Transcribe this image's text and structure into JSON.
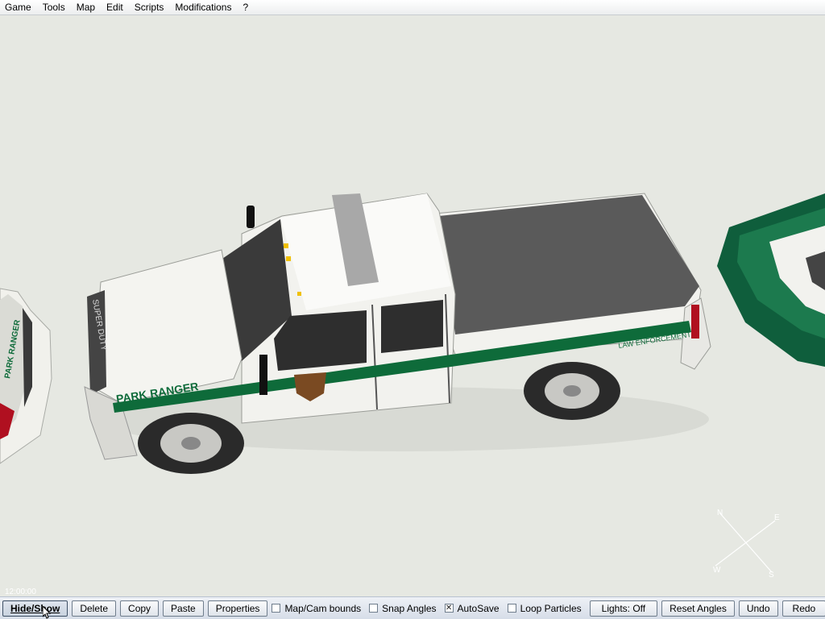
{
  "menu": {
    "items": [
      {
        "label": "Game"
      },
      {
        "label": "Tools"
      },
      {
        "label": "Map"
      },
      {
        "label": "Edit"
      },
      {
        "label": "Scripts"
      },
      {
        "label": "Modifications"
      },
      {
        "label": "?"
      }
    ]
  },
  "viewport": {
    "time": "12:00:00",
    "vehicle_text": {
      "side_label": "PARK RANGER",
      "bed_label": "LAW ENFORCEMENT",
      "hood_label": "SUPER DUTY",
      "left_car_label": "PARK RANGER"
    },
    "compass": {
      "n": "N",
      "e": "E",
      "s": "S",
      "w": "W"
    }
  },
  "toolbar": {
    "hide_show": "Hide/Show",
    "delete": "Delete",
    "copy": "Copy",
    "paste": "Paste",
    "properties": "Properties",
    "map_cam_bounds": {
      "label": "Map/Cam bounds",
      "checked": false
    },
    "snap_angles": {
      "label": "Snap Angles",
      "checked": false
    },
    "autosave": {
      "label": "AutoSave",
      "checked": true
    },
    "loop_particles": {
      "label": "Loop Particles",
      "checked": false
    },
    "lights": "Lights: Off",
    "reset_angles": "Reset Angles",
    "undo": "Undo",
    "redo": "Redo"
  },
  "colors": {
    "ranger_green": "#0e6b3a",
    "truck_white": "#f2f2ee",
    "bed_cover": "#5a5a5a",
    "boat_green": "#0f5e3c"
  }
}
